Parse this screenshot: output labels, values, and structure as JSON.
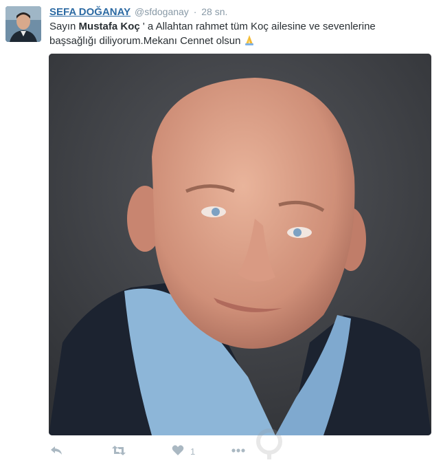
{
  "tweet": {
    "fullname": "SEFA DOĞANAY",
    "username": "@sfdoganay",
    "separator": "·",
    "time": "28 sn.",
    "text_part1": "Sayın ",
    "text_bold": "Mustafa Koç",
    "text_part2": " ' a Allahtan rahmet tüm Koç ailesine ve sevenlerine başsağlığı diliyorum.Mekanı Cennet olsun",
    "emoji": "folded-hands-emoji",
    "like_count": "1"
  },
  "icons": {
    "reply": "reply-icon",
    "retweet": "retweet-icon",
    "like": "heart-icon",
    "more": "more-icon"
  },
  "colors": {
    "fullname": "#2c6aa3",
    "meta": "#8899a6",
    "action": "#aab8c2"
  }
}
